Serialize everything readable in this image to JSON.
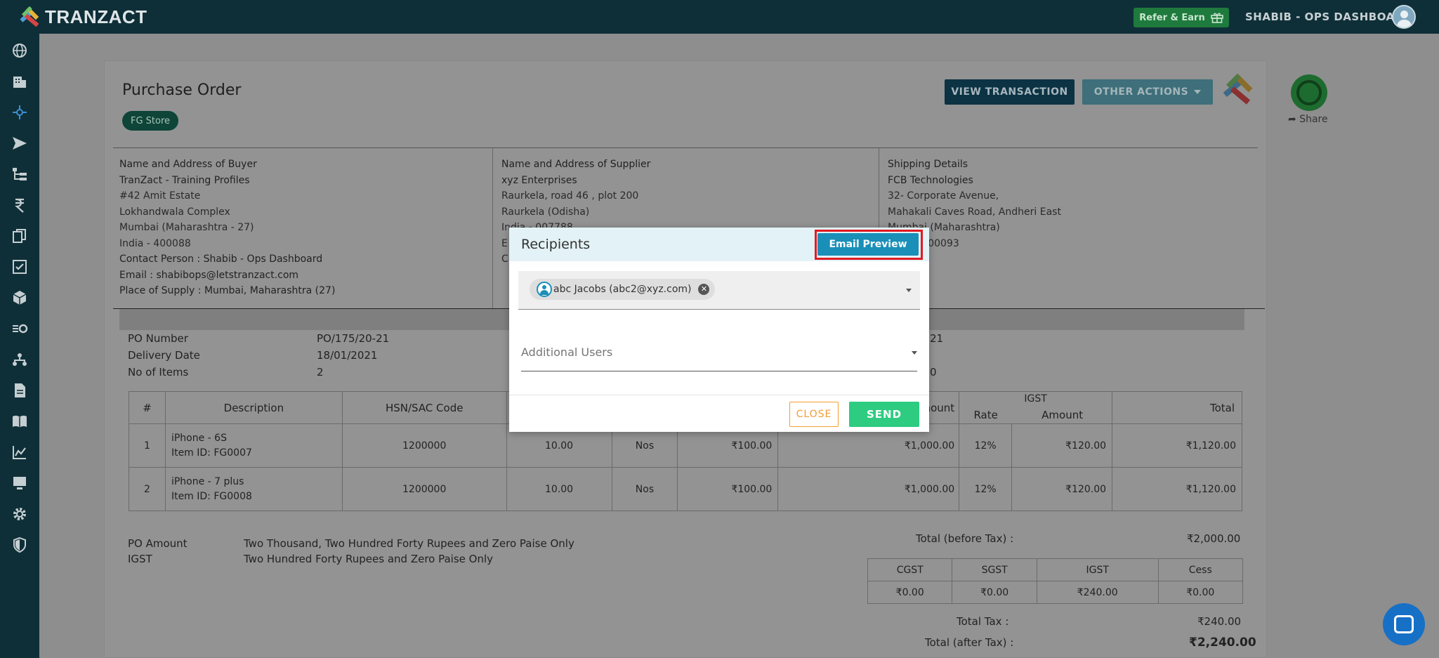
{
  "brand": {
    "name": "TRANZACT"
  },
  "header": {
    "refer_label": "Refer & Earn",
    "user_label": "SHABIB - OPS DASHBOARD"
  },
  "sidebar": {
    "icons": [
      "globe-icon",
      "building-icon",
      "plus-icon",
      "send-icon",
      "hierarchy-icon",
      "rupee-icon",
      "documents-icon",
      "checklist-icon",
      "box-icon",
      "workflow-icon",
      "org-icon",
      "file-icon",
      "book-icon",
      "chart-icon",
      "monitor-icon",
      "gear-icon",
      "shield-icon"
    ]
  },
  "document": {
    "title": "Purchase Order",
    "store": "FG Store",
    "view_transaction": "VIEW TRANSACTION",
    "other_actions": "OTHER ACTIONS",
    "share": "Share"
  },
  "buyer": {
    "heading": "Name and Address of Buyer",
    "name": "TranZact - Training Profiles",
    "line1": "#42 Amit Estate",
    "line2": "Lokhandwala Complex",
    "line3": "Mumbai (Maharashtra - 27)",
    "line4": "India - 400088",
    "contact_label": "Contact Person :",
    "contact_value": "Shabib - Ops Dashboard",
    "email_label": "Email :",
    "email_value": "shabibops@letstranzact.com",
    "supply_label": "Place of Supply :",
    "supply_value": "Mumbai, Maharashtra (27)"
  },
  "supplier": {
    "heading": "Name and Address of Supplier",
    "name": "xyz Enterprises",
    "line1": "Raurkela, road 46 , plot 200",
    "line2": "Raurkela (Odisha)",
    "line3": "India - 007788",
    "line4": "E",
    "line5": "C"
  },
  "shipping": {
    "heading": "Shipping Details",
    "name": "FCB Technologies",
    "line1": "32- Corporate Avenue,",
    "line2": "Mahakali Caves Road, Andheri East",
    "line3": "Mumbai (Maharashtra)",
    "line4": "India - 400093"
  },
  "po_meta": {
    "po_number_label": "PO Number",
    "po_number": "PO/175/20-21",
    "delivery_label": "Delivery Date",
    "delivery": "18/01/2021",
    "items_label": "No of Items",
    "items": "2",
    "right_val1": "21",
    "right_val2": "0"
  },
  "items_table": {
    "headers": {
      "num": "#",
      "desc": "Description",
      "hsn": "HSN/SAC Code",
      "amount": "Amount",
      "igst": "IGST",
      "rate": "Rate",
      "igst_amount": "Amount",
      "total": "Total"
    },
    "rows": [
      {
        "num": "1",
        "desc": "iPhone - 6S",
        "item_id": "Item ID: FG0007",
        "hsn": "1200000",
        "qty": "10.00",
        "unit": "Nos",
        "price": "₹100.00",
        "amount": "₹1,000.00",
        "rate": "12%",
        "igst_amount": "₹120.00",
        "total": "₹1,120.00"
      },
      {
        "num": "2",
        "desc": "iPhone - 7 plus",
        "item_id": "Item ID: FG0008",
        "hsn": "1200000",
        "qty": "10.00",
        "unit": "Nos",
        "price": "₹100.00",
        "amount": "₹1,000.00",
        "rate": "12%",
        "igst_amount": "₹120.00",
        "total": "₹1,120.00"
      }
    ]
  },
  "summary": {
    "po_amount_label": "PO Amount",
    "po_amount_words": "Two Thousand, Two Hundred Forty Rupees and Zero Paise Only",
    "igst_label": "IGST",
    "igst_words": "Two Hundred Forty Rupees and Zero Paise Only",
    "before_tax_label": "Total (before Tax) :",
    "before_tax": "₹2,000.00",
    "tax_headers": [
      "CGST",
      "SGST",
      "IGST",
      "Cess"
    ],
    "tax_values": [
      "₹0.00",
      "₹0.00",
      "₹240.00",
      "₹0.00"
    ],
    "total_tax_label": "Total Tax :",
    "total_tax": "₹240.00",
    "after_tax_label": "Total (after Tax) :",
    "after_tax": "₹2,240.00"
  },
  "modal": {
    "title": "Recipients",
    "email_preview": "Email Preview",
    "recipient_chip": "abc Jacobs (abc2@xyz.com)",
    "additional_users": "Additional Users",
    "close": "CLOSE",
    "send": "SEND"
  },
  "colors": {
    "accent": "#1a8fb8",
    "send": "#2ecc81",
    "close": "#f39c34",
    "highlight": "#e01b24",
    "sidebar": "#0f2f38"
  }
}
